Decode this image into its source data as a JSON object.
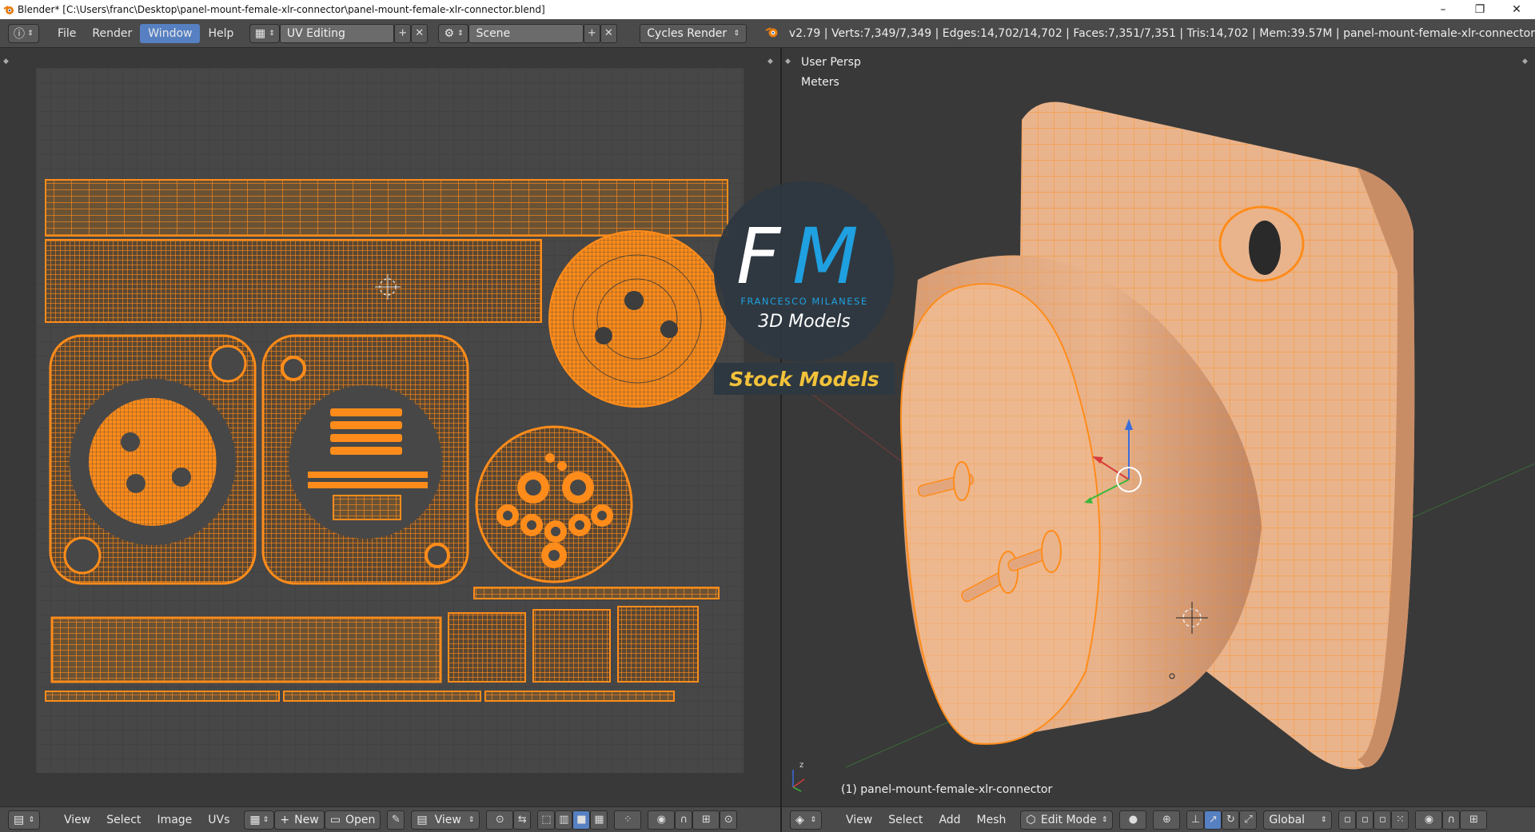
{
  "window": {
    "title": "Blender* [C:\\Users\\franc\\Desktop\\panel-mount-female-xlr-connector\\panel-mount-female-xlr-connector.blend]",
    "minimize": "–",
    "maximize": "❐",
    "close": "✕"
  },
  "infobar": {
    "editor_icon": "ⓘ",
    "menus": [
      "File",
      "Render",
      "Window",
      "Help"
    ],
    "active_menu": "Window",
    "screen_layout": "UV Editing",
    "scene": "Scene",
    "render_engine": "Cycles Render",
    "stats": "v2.79 | Verts:7,349/7,349 | Edges:14,702/14,702 | Faces:7,351/7,351 | Tris:14,702 | Mem:39.57M | panel-mount-female-xlr-connector"
  },
  "viewport": {
    "view_name": "User Persp",
    "units": "Meters",
    "object_label": "(1) panel-mount-female-xlr-connector"
  },
  "uv_bottom": {
    "menus": [
      "View",
      "Select",
      "Image",
      "UVs"
    ],
    "new_label": "New",
    "open_label": "Open",
    "view_label": "View"
  },
  "vp_bottom": {
    "menus": [
      "View",
      "Select",
      "Add",
      "Mesh"
    ],
    "mode": "Edit Mode",
    "orientation": "Global"
  },
  "watermark": {
    "initials_f": "F",
    "initials_m": "M",
    "brand": "FRANCESCO MILANESE",
    "subtitle": "3D Models",
    "banner": "Stock Models"
  },
  "colors": {
    "uv_orange": "#ff8c1a",
    "mesh_body": "#e9b48c",
    "active_blue": "#5680c2",
    "watermark_blue": "#1fa0e0",
    "watermark_gold": "#f2c23a"
  }
}
